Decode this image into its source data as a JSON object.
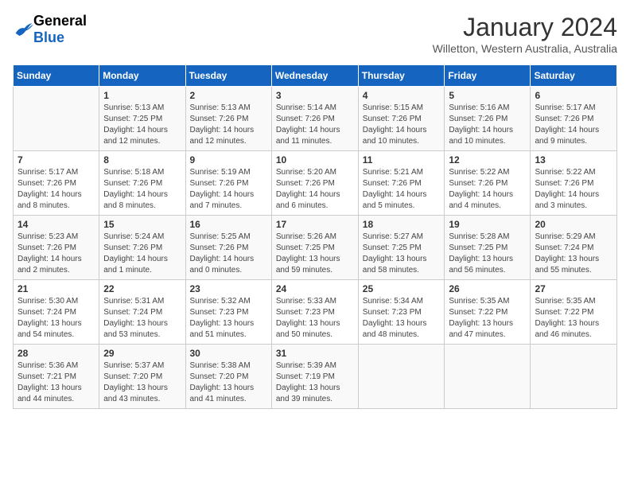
{
  "header": {
    "logo_general": "General",
    "logo_blue": "Blue",
    "title": "January 2024",
    "subtitle": "Willetton, Western Australia, Australia"
  },
  "days_of_week": [
    "Sunday",
    "Monday",
    "Tuesday",
    "Wednesday",
    "Thursday",
    "Friday",
    "Saturday"
  ],
  "weeks": [
    [
      {
        "day": "",
        "info": ""
      },
      {
        "day": "1",
        "info": "Sunrise: 5:13 AM\nSunset: 7:25 PM\nDaylight: 14 hours and 12 minutes."
      },
      {
        "day": "2",
        "info": "Sunrise: 5:13 AM\nSunset: 7:26 PM\nDaylight: 14 hours and 12 minutes."
      },
      {
        "day": "3",
        "info": "Sunrise: 5:14 AM\nSunset: 7:26 PM\nDaylight: 14 hours and 11 minutes."
      },
      {
        "day": "4",
        "info": "Sunrise: 5:15 AM\nSunset: 7:26 PM\nDaylight: 14 hours and 10 minutes."
      },
      {
        "day": "5",
        "info": "Sunrise: 5:16 AM\nSunset: 7:26 PM\nDaylight: 14 hours and 10 minutes."
      },
      {
        "day": "6",
        "info": "Sunrise: 5:17 AM\nSunset: 7:26 PM\nDaylight: 14 hours and 9 minutes."
      }
    ],
    [
      {
        "day": "7",
        "info": "Sunrise: 5:17 AM\nSunset: 7:26 PM\nDaylight: 14 hours and 8 minutes."
      },
      {
        "day": "8",
        "info": "Sunrise: 5:18 AM\nSunset: 7:26 PM\nDaylight: 14 hours and 8 minutes."
      },
      {
        "day": "9",
        "info": "Sunrise: 5:19 AM\nSunset: 7:26 PM\nDaylight: 14 hours and 7 minutes."
      },
      {
        "day": "10",
        "info": "Sunrise: 5:20 AM\nSunset: 7:26 PM\nDaylight: 14 hours and 6 minutes."
      },
      {
        "day": "11",
        "info": "Sunrise: 5:21 AM\nSunset: 7:26 PM\nDaylight: 14 hours and 5 minutes."
      },
      {
        "day": "12",
        "info": "Sunrise: 5:22 AM\nSunset: 7:26 PM\nDaylight: 14 hours and 4 minutes."
      },
      {
        "day": "13",
        "info": "Sunrise: 5:22 AM\nSunset: 7:26 PM\nDaylight: 14 hours and 3 minutes."
      }
    ],
    [
      {
        "day": "14",
        "info": "Sunrise: 5:23 AM\nSunset: 7:26 PM\nDaylight: 14 hours and 2 minutes."
      },
      {
        "day": "15",
        "info": "Sunrise: 5:24 AM\nSunset: 7:26 PM\nDaylight: 14 hours and 1 minute."
      },
      {
        "day": "16",
        "info": "Sunrise: 5:25 AM\nSunset: 7:26 PM\nDaylight: 14 hours and 0 minutes."
      },
      {
        "day": "17",
        "info": "Sunrise: 5:26 AM\nSunset: 7:25 PM\nDaylight: 13 hours and 59 minutes."
      },
      {
        "day": "18",
        "info": "Sunrise: 5:27 AM\nSunset: 7:25 PM\nDaylight: 13 hours and 58 minutes."
      },
      {
        "day": "19",
        "info": "Sunrise: 5:28 AM\nSunset: 7:25 PM\nDaylight: 13 hours and 56 minutes."
      },
      {
        "day": "20",
        "info": "Sunrise: 5:29 AM\nSunset: 7:24 PM\nDaylight: 13 hours and 55 minutes."
      }
    ],
    [
      {
        "day": "21",
        "info": "Sunrise: 5:30 AM\nSunset: 7:24 PM\nDaylight: 13 hours and 54 minutes."
      },
      {
        "day": "22",
        "info": "Sunrise: 5:31 AM\nSunset: 7:24 PM\nDaylight: 13 hours and 53 minutes."
      },
      {
        "day": "23",
        "info": "Sunrise: 5:32 AM\nSunset: 7:23 PM\nDaylight: 13 hours and 51 minutes."
      },
      {
        "day": "24",
        "info": "Sunrise: 5:33 AM\nSunset: 7:23 PM\nDaylight: 13 hours and 50 minutes."
      },
      {
        "day": "25",
        "info": "Sunrise: 5:34 AM\nSunset: 7:23 PM\nDaylight: 13 hours and 48 minutes."
      },
      {
        "day": "26",
        "info": "Sunrise: 5:35 AM\nSunset: 7:22 PM\nDaylight: 13 hours and 47 minutes."
      },
      {
        "day": "27",
        "info": "Sunrise: 5:35 AM\nSunset: 7:22 PM\nDaylight: 13 hours and 46 minutes."
      }
    ],
    [
      {
        "day": "28",
        "info": "Sunrise: 5:36 AM\nSunset: 7:21 PM\nDaylight: 13 hours and 44 minutes."
      },
      {
        "day": "29",
        "info": "Sunrise: 5:37 AM\nSunset: 7:20 PM\nDaylight: 13 hours and 43 minutes."
      },
      {
        "day": "30",
        "info": "Sunrise: 5:38 AM\nSunset: 7:20 PM\nDaylight: 13 hours and 41 minutes."
      },
      {
        "day": "31",
        "info": "Sunrise: 5:39 AM\nSunset: 7:19 PM\nDaylight: 13 hours and 39 minutes."
      },
      {
        "day": "",
        "info": ""
      },
      {
        "day": "",
        "info": ""
      },
      {
        "day": "",
        "info": ""
      }
    ]
  ]
}
